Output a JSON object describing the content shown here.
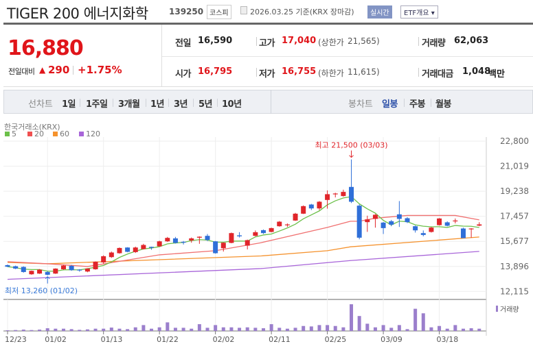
{
  "header": {
    "title": "TIGER 200 에너지화학",
    "code": "139250",
    "market": "코스피",
    "date": "2026.03.25 기준(KRX 장마감)",
    "realtime": "실시간",
    "etf_info": "ETF개요 ▾"
  },
  "price": {
    "current": "16,880",
    "change_label": "전일대비",
    "change_arrow": "▲",
    "change": "290",
    "change_pct": "+1.75%"
  },
  "stats": [
    {
      "label": "전일",
      "value": "16,590"
    },
    {
      "label": "고가",
      "value": "17,040",
      "sub_label": "(상한가",
      "sub_value": "21,565)"
    },
    {
      "label": "거래량",
      "value": "62,063"
    },
    {
      "label": "시가",
      "value": "16,795"
    },
    {
      "label": "저가",
      "value": "16,755",
      "sub_label": "(하한가",
      "sub_value": "11,615)"
    },
    {
      "label": "거래대금",
      "value": "1,048",
      "unit": "백만"
    }
  ],
  "line_tabs": {
    "label": "선차트",
    "items": [
      "1일",
      "1주일",
      "3개월",
      "1년",
      "3년",
      "5년",
      "10년"
    ]
  },
  "candle_tabs": {
    "label": "봉차트",
    "items": [
      "일봉",
      "주봉",
      "월봉"
    ],
    "active": "일봉"
  },
  "colors": {
    "up": "#e0252a",
    "down": "#2f6fd8",
    "ma5": "#6cc04a",
    "ma20": "#f07070",
    "ma60": "#f5922d",
    "ma120": "#a865d9",
    "volume": "#9b7fcc"
  },
  "chart_data": {
    "type": "candlestick",
    "exchange": "한국거래소(KRX)",
    "legend": [
      "5",
      "20",
      "60",
      "120"
    ],
    "y_ticks": [
      "22,800",
      "21,019",
      "19,238",
      "17,457",
      "15,677",
      "13,896",
      "12,115"
    ],
    "ylim": [
      12115,
      22800
    ],
    "x_ticks": [
      {
        "index": 0,
        "label": "12/23"
      },
      {
        "index": 5,
        "label": "01/02"
      },
      {
        "index": 12,
        "label": "01/13"
      },
      {
        "index": 19,
        "label": "01/22"
      },
      {
        "index": 26,
        "label": "02/02"
      },
      {
        "index": 33,
        "label": "02/11"
      },
      {
        "index": 40,
        "label": "02/25"
      },
      {
        "index": 47,
        "label": "03/09"
      },
      {
        "index": 54,
        "label": "03/18"
      }
    ],
    "high_note": "최고 21,500 (03/03)",
    "high_index": 43,
    "high_value": 21500,
    "low_note": "최저 13,260 (01/02)",
    "low_index": 5,
    "low_value": 13260,
    "volume_label": "거래량",
    "ohlc": [
      [
        13984,
        14030,
        13850,
        13871
      ],
      [
        13905,
        13950,
        13700,
        13740
      ],
      [
        13857,
        13900,
        13450,
        13496
      ],
      [
        13335,
        13600,
        13300,
        13579
      ],
      [
        13384,
        13700,
        13360,
        13662
      ],
      [
        13496,
        13560,
        13260,
        13301
      ],
      [
        13384,
        13760,
        13360,
        13740
      ],
      [
        13691,
        14000,
        13650,
        13954
      ],
      [
        13935,
        14000,
        13580,
        13628
      ],
      [
        13662,
        13700,
        13520,
        13613
      ],
      [
        13530,
        13760,
        13480,
        13740
      ],
      [
        13691,
        14250,
        13660,
        14228
      ],
      [
        14179,
        14680,
        14100,
        14618
      ],
      [
        14555,
        14950,
        14500,
        14882
      ],
      [
        14833,
        15240,
        14800,
        15204
      ],
      [
        15238,
        15260,
        14900,
        14931
      ],
      [
        14911,
        15300,
        14850,
        15238
      ],
      [
        15126,
        15500,
        15100,
        15419
      ],
      [
        15287,
        15300,
        15080,
        15223
      ],
      [
        15321,
        15720,
        15300,
        15677
      ],
      [
        15677,
        15990,
        15640,
        15921
      ],
      [
        15887,
        15990,
        15520,
        15565
      ],
      [
        15643,
        15700,
        15450,
        15594
      ],
      [
        15740,
        15950,
        15580,
        15887
      ],
      [
        15936,
        16030,
        15500,
        16004
      ],
      [
        16067,
        16200,
        15700,
        15774
      ],
      [
        15677,
        15700,
        14800,
        14833
      ],
      [
        15189,
        15600,
        14950,
        15579
      ],
      [
        15565,
        16300,
        15540,
        16262
      ],
      [
        16101,
        16330,
        15950,
        16033
      ],
      [
        15370,
        15800,
        15100,
        15760
      ],
      [
        16067,
        16450,
        16040,
        16326
      ],
      [
        16472,
        16520,
        16200,
        16262
      ],
      [
        16345,
        16650,
        16320,
        16618
      ],
      [
        16750,
        17120,
        16720,
        17073
      ],
      [
        16829,
        16950,
        16700,
        16877
      ],
      [
        17155,
        17700,
        17130,
        17643
      ],
      [
        17643,
        18230,
        17620,
        18180
      ],
      [
        18294,
        18340,
        17900,
        18017
      ],
      [
        18017,
        18540,
        17900,
        18492
      ],
      [
        18619,
        19300,
        18000,
        19029
      ],
      [
        19029,
        19130,
        18800,
        19077
      ],
      [
        18897,
        19350,
        18850,
        19190
      ],
      [
        19546,
        21500,
        18400,
        18492
      ],
      [
        18214,
        18300,
        15820,
        15936
      ],
      [
        17043,
        17500,
        16350,
        17238
      ],
      [
        17272,
        17620,
        16650,
        17565
      ],
      [
        17009,
        17050,
        16200,
        16618
      ],
      [
        17107,
        17200,
        16750,
        16862
      ],
      [
        17597,
        18540,
        16700,
        17272
      ],
      [
        17321,
        17400,
        16980,
        17043
      ],
      [
        16750,
        16800,
        16300,
        16457
      ],
      [
        16262,
        16450,
        16030,
        16130
      ],
      [
        16345,
        16700,
        16300,
        16652
      ],
      [
        16829,
        17330,
        16800,
        17302
      ],
      [
        17029,
        17100,
        16740,
        16784
      ],
      [
        17126,
        17300,
        16950,
        17155
      ],
      [
        16589,
        16650,
        15906,
        15906
      ],
      [
        16560,
        16610,
        15936,
        16589
      ],
      [
        16795,
        17040,
        16755,
        16880
      ]
    ],
    "ma20": [
      [
        0,
        14228
      ],
      [
        5,
        14082
      ],
      [
        10,
        13887
      ],
      [
        19,
        14716
      ],
      [
        26,
        15009
      ],
      [
        31.7,
        15579
      ],
      [
        40,
        16667
      ],
      [
        42.9,
        17106
      ],
      [
        44,
        17106
      ],
      [
        46,
        17321
      ],
      [
        50,
        17516
      ],
      [
        56,
        17516
      ],
      [
        59,
        17204
      ]
    ],
    "ma60": [
      [
        0,
        14179
      ],
      [
        5,
        14082
      ],
      [
        31.7,
        14638
      ],
      [
        40,
        15009
      ],
      [
        42.9,
        15287
      ],
      [
        59,
        15984
      ]
    ],
    "ma120": [
      [
        0,
        12978
      ],
      [
        31.7,
        13740
      ],
      [
        42.9,
        14311
      ],
      [
        59,
        14960
      ]
    ],
    "volume_relative": [
      3,
      4,
      6,
      4,
      6,
      12,
      10,
      10,
      8,
      5,
      7,
      10,
      10,
      15,
      10,
      8,
      16,
      26,
      10,
      16,
      38,
      14,
      14,
      10,
      30,
      14,
      26,
      16,
      16,
      14,
      16,
      14,
      12,
      30,
      14,
      10,
      14,
      22,
      20,
      26,
      26,
      22,
      16,
      118,
      66,
      32,
      16,
      26,
      14,
      26,
      8,
      98,
      78,
      16,
      22,
      10,
      26,
      10,
      12,
      10
    ]
  }
}
